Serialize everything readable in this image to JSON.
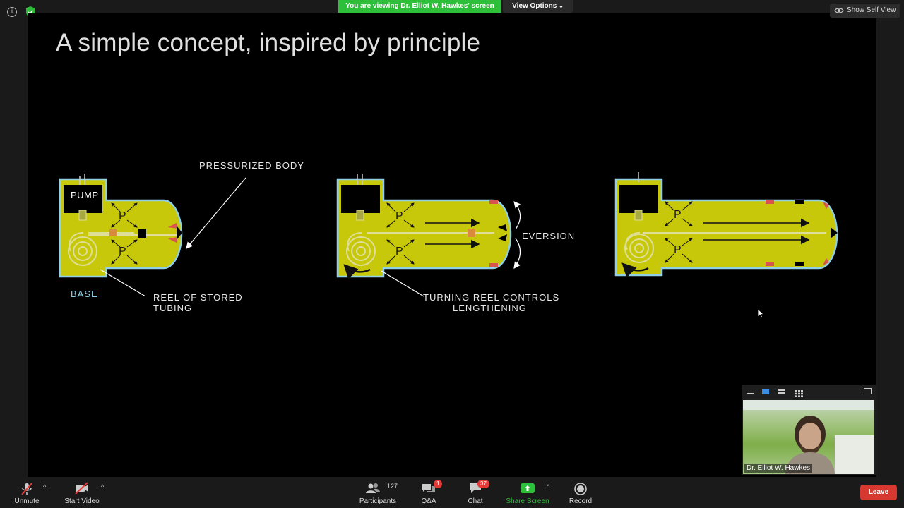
{
  "top_bar": {
    "viewing_banner": "You are viewing Dr. Elliot W. Hawkes' screen",
    "view_options": "View Options",
    "show_self_view": "Show Self View"
  },
  "slide": {
    "title": "A simple concept, inspired by principle",
    "labels": {
      "pressurized_body": "PRESSURIZED BODY",
      "pump": "PUMP",
      "base": "BASE",
      "reel_line1": "REEL OF STORED",
      "reel_line2": "TUBING",
      "eversion": "EVERSION",
      "turning_line1": "TURNING REEL CONTROLS",
      "turning_line2": "LENGTHENING",
      "p": "P"
    },
    "colors": {
      "body": "#c8c80a",
      "outline": "#8fd0e6",
      "tip": "#d9534f"
    }
  },
  "video": {
    "participant_name": "Dr. Elliot W. Hawkes"
  },
  "toolbar": {
    "unmute": "Unmute",
    "start_video": "Start Video",
    "participants": "Participants",
    "participants_count": "127",
    "qa": "Q&A",
    "qa_badge": "1",
    "chat": "Chat",
    "chat_badge": "37",
    "share_screen": "Share Screen",
    "record": "Record",
    "leave": "Leave"
  }
}
